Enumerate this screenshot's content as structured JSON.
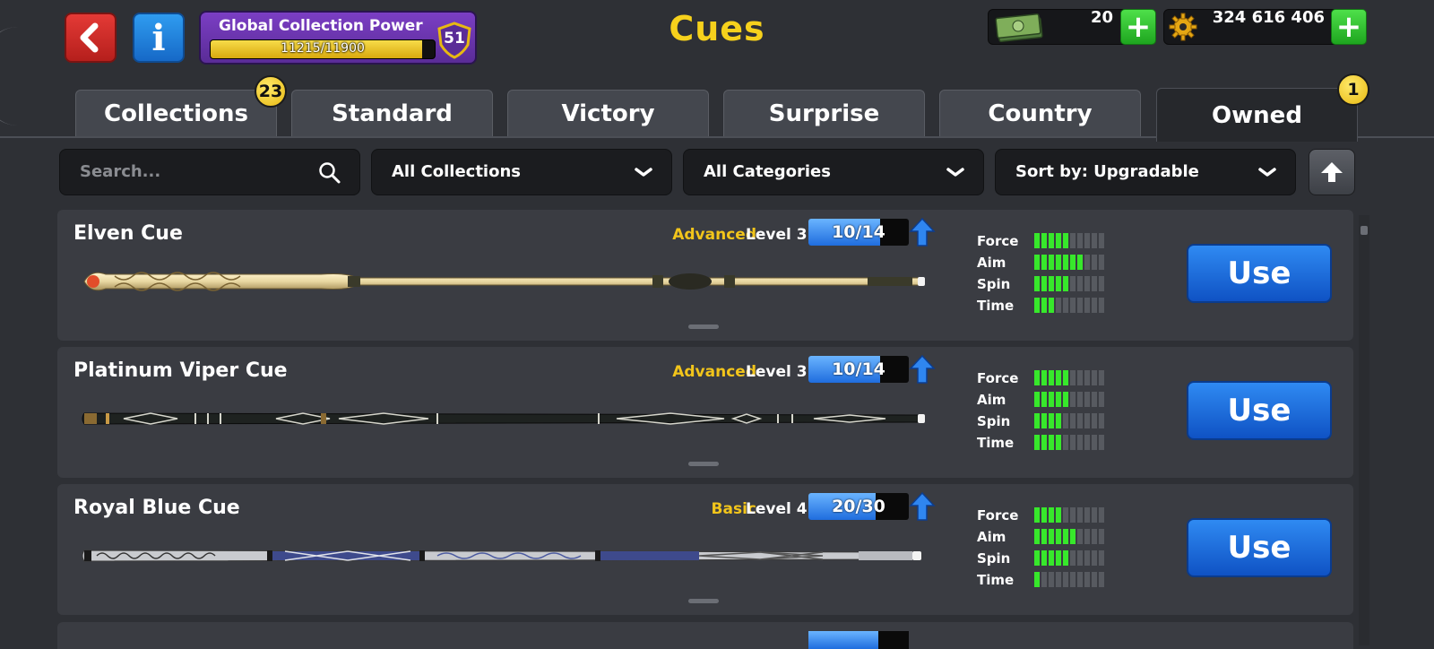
{
  "header": {
    "title": "Cues",
    "back_icon": "back-arrow-icon",
    "info_icon": "info-icon",
    "info_label": "i",
    "global_collection_power": {
      "label": "Global Collection Power",
      "progress_text": "11215/11900",
      "progress_fraction": 0.942,
      "level": "51"
    },
    "cash": {
      "value": "20",
      "icon": "cash-icon"
    },
    "coins": {
      "value": "324 616 406",
      "icon": "coin-gear-icon"
    },
    "plus_label": "+"
  },
  "tabs": [
    {
      "label": "Collections",
      "badge": "23",
      "active": false
    },
    {
      "label": "Standard",
      "active": false
    },
    {
      "label": "Victory",
      "active": false
    },
    {
      "label": "Surprise",
      "active": false
    },
    {
      "label": "Country",
      "active": false
    },
    {
      "label": "Owned",
      "badge": "1",
      "active": true
    }
  ],
  "filters": {
    "search_placeholder": "Search...",
    "collections": "All Collections",
    "categories": "All Categories",
    "sort": "Sort by: Upgradable"
  },
  "stat_labels": [
    "Force",
    "Aim",
    "Spin",
    "Time"
  ],
  "cues": [
    {
      "name": "Elven Cue",
      "tier": "Advanced",
      "level": "Level 3",
      "progress_text": "10/14",
      "progress_fraction": 0.714,
      "stats": {
        "force": 5,
        "aim": 7,
        "spin": 5,
        "time": 3
      },
      "button": "Use"
    },
    {
      "name": "Platinum Viper Cue",
      "tier": "Advanced",
      "level": "Level 3",
      "progress_text": "10/14",
      "progress_fraction": 0.714,
      "stats": {
        "force": 5,
        "aim": 5,
        "spin": 4,
        "time": 4
      },
      "button": "Use"
    },
    {
      "name": "Royal Blue Cue",
      "tier": "Basic",
      "level": "Level 4",
      "progress_text": "20/30",
      "progress_fraction": 0.667,
      "stats": {
        "force": 4,
        "aim": 6,
        "spin": 5,
        "time": 1
      },
      "button": "Use"
    }
  ],
  "colors": {
    "accent_yellow": "#f6d11c",
    "stat_on": "#37e82b",
    "use_button": "#1f6ee0"
  }
}
